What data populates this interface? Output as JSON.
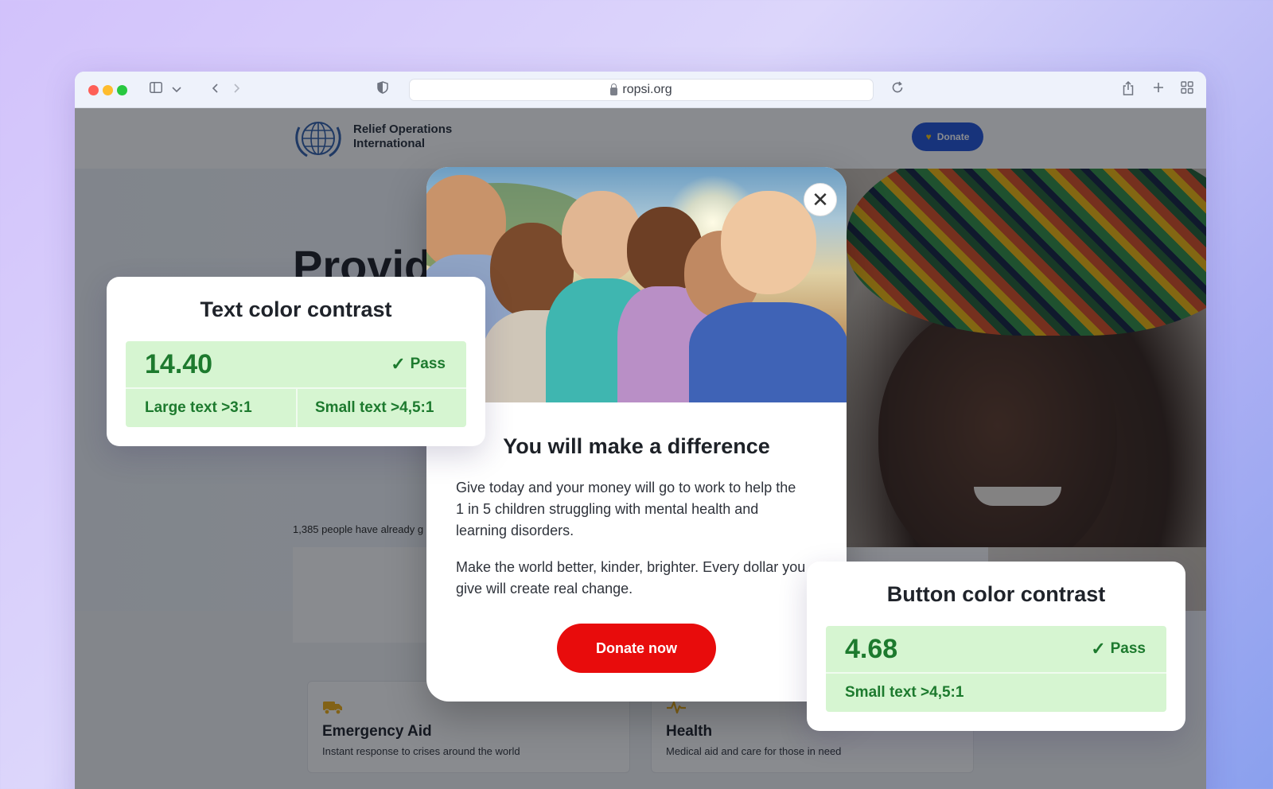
{
  "browser": {
    "url": "ropsi.org"
  },
  "site": {
    "org_name_line1": "Relief Operations",
    "org_name_line2": "International",
    "donate_label": "Donate",
    "hero_title": "Provid",
    "hero_meta": "1,385 people have already g",
    "services": [
      {
        "title": "Emergency Aid",
        "desc": "Instant response to crises around the world",
        "icon": "truck-icon"
      },
      {
        "title": "Health",
        "desc": "Medical aid and care for those in need",
        "icon": "heartbeat-icon"
      }
    ]
  },
  "modal": {
    "title": "You will make a difference",
    "paragraph1": "Give today and your money will go to work to help the 1 in 5 children struggling with mental health and learning disorders.",
    "paragraph2": "Make the world better, kinder, brighter. Every dollar you give will create real change.",
    "cta": "Donate now",
    "close_glyph": "✕"
  },
  "text_contrast": {
    "title": "Text color contrast",
    "ratio": "14.40",
    "status": "Pass",
    "large_text": "Large text >3:1",
    "small_text": "Small text >4,5:1"
  },
  "button_contrast": {
    "title": "Button color contrast",
    "ratio": "4.68",
    "status": "Pass",
    "small_text": "Small text >4,5:1"
  },
  "colors": {
    "accent_blue": "#1b4fd6",
    "cta_red": "#e80c0c",
    "pass_green_bg": "#d6f5d1",
    "pass_green_text": "#1d7a2e"
  }
}
